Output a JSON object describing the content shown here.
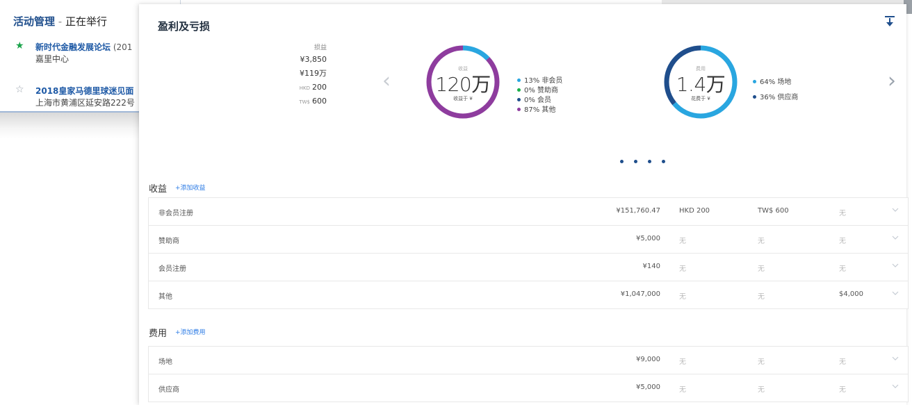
{
  "background_window": {
    "title_strong": "活动管理",
    "title_sep": " - ",
    "title_rest": "正在举行",
    "events": [
      {
        "starred": true,
        "name": "新时代金融发展论坛",
        "name_extra": " (201",
        "address": "嘉里中心"
      },
      {
        "starred": false,
        "name": "2018皇家马德里球迷见面",
        "name_extra": "",
        "address": "上海市黄浦区延安路222号"
      }
    ]
  },
  "panel": {
    "title": "盈利及亏损",
    "download_icon": "download-icon",
    "summary": {
      "label": "损益",
      "values": [
        {
          "prefix": "",
          "value": "¥3,850"
        },
        {
          "prefix": "",
          "value": "¥119万"
        },
        {
          "prefix": "HKD",
          "value": "200"
        },
        {
          "prefix": "TW$",
          "value": "600"
        }
      ]
    },
    "prev_arrow": "‹",
    "next_arrow": "›",
    "income_donut": {
      "top_label": "收益",
      "big_value": "120万",
      "sub_label": "收益于 ¥",
      "legend": [
        {
          "label": "13% 非会员",
          "color": "#29a6e0",
          "percent": 13
        },
        {
          "label": "0% 赞助商",
          "color": "#1ab04a",
          "percent": 0
        },
        {
          "label": "0% 会员",
          "color": "#1f4e8c",
          "percent": 0
        },
        {
          "label": "87% 其他",
          "color": "#8e3c9e",
          "percent": 87
        }
      ]
    },
    "expense_donut": {
      "top_label": "费用",
      "big_value": "1.4万",
      "sub_label": "花费于 ¥",
      "legend": [
        {
          "label": "64% 场地",
          "color": "#29a6e0",
          "percent": 64
        },
        {
          "label": "36% 供应商",
          "color": "#1f4e8c",
          "percent": 36
        }
      ]
    },
    "pager_count": 4
  },
  "income": {
    "title": "收益",
    "add_label": "+添加收益",
    "rows": [
      {
        "name": "非会员注册",
        "rmb": "¥151,760.47",
        "hkd": "HKD 200",
        "twd": "TW$ 600",
        "other": "无"
      },
      {
        "name": "赞助商",
        "rmb": "¥5,000",
        "hkd": "无",
        "twd": "无",
        "other": "无"
      },
      {
        "name": "会员注册",
        "rmb": "¥140",
        "hkd": "无",
        "twd": "无",
        "other": "无"
      },
      {
        "name": "其他",
        "rmb": "¥1,047,000",
        "hkd": "无",
        "twd": "无",
        "other": "$4,000"
      }
    ]
  },
  "expense": {
    "title": "费用",
    "add_label": "+添加费用",
    "rows": [
      {
        "name": "场地",
        "rmb": "¥9,000",
        "hkd": "无",
        "twd": "无",
        "other": "无"
      },
      {
        "name": "供应商",
        "rmb": "¥5,000",
        "hkd": "无",
        "twd": "无",
        "other": "无"
      }
    ]
  }
}
